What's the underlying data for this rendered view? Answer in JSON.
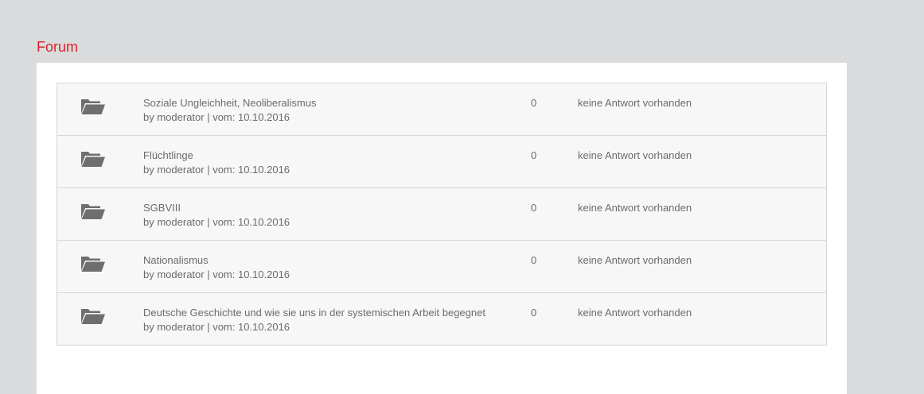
{
  "page": {
    "title": "Forum"
  },
  "colors": {
    "accent": "#d8232a",
    "background": "#dadbdc",
    "panel": "#ffffff",
    "row": "#f7f7f7",
    "text": "#6b6b6b",
    "icon": "#6e6e6e"
  },
  "topics": [
    {
      "icon": "folder-open-icon",
      "title": "Soziale Ungleichheit, Neoliberalismus",
      "meta": "by moderator | vom: 10.10.2016",
      "replies": "0",
      "last_reply": "keine Antwort vorhanden"
    },
    {
      "icon": "folder-open-icon",
      "title": "Flüchtlinge",
      "meta": "by moderator | vom: 10.10.2016",
      "replies": "0",
      "last_reply": "keine Antwort vorhanden"
    },
    {
      "icon": "folder-open-icon",
      "title": "SGBVIII",
      "meta": "by moderator | vom: 10.10.2016",
      "replies": "0",
      "last_reply": "keine Antwort vorhanden"
    },
    {
      "icon": "folder-open-icon",
      "title": "Nationalismus",
      "meta": "by moderator | vom: 10.10.2016",
      "replies": "0",
      "last_reply": "keine Antwort vorhanden"
    },
    {
      "icon": "folder-open-icon",
      "title": "Deutsche Geschichte und wie sie uns in der systemischen Arbeit begegnet",
      "meta": "by moderator | vom: 10.10.2016",
      "replies": "0",
      "last_reply": "keine Antwort vorhanden"
    }
  ]
}
